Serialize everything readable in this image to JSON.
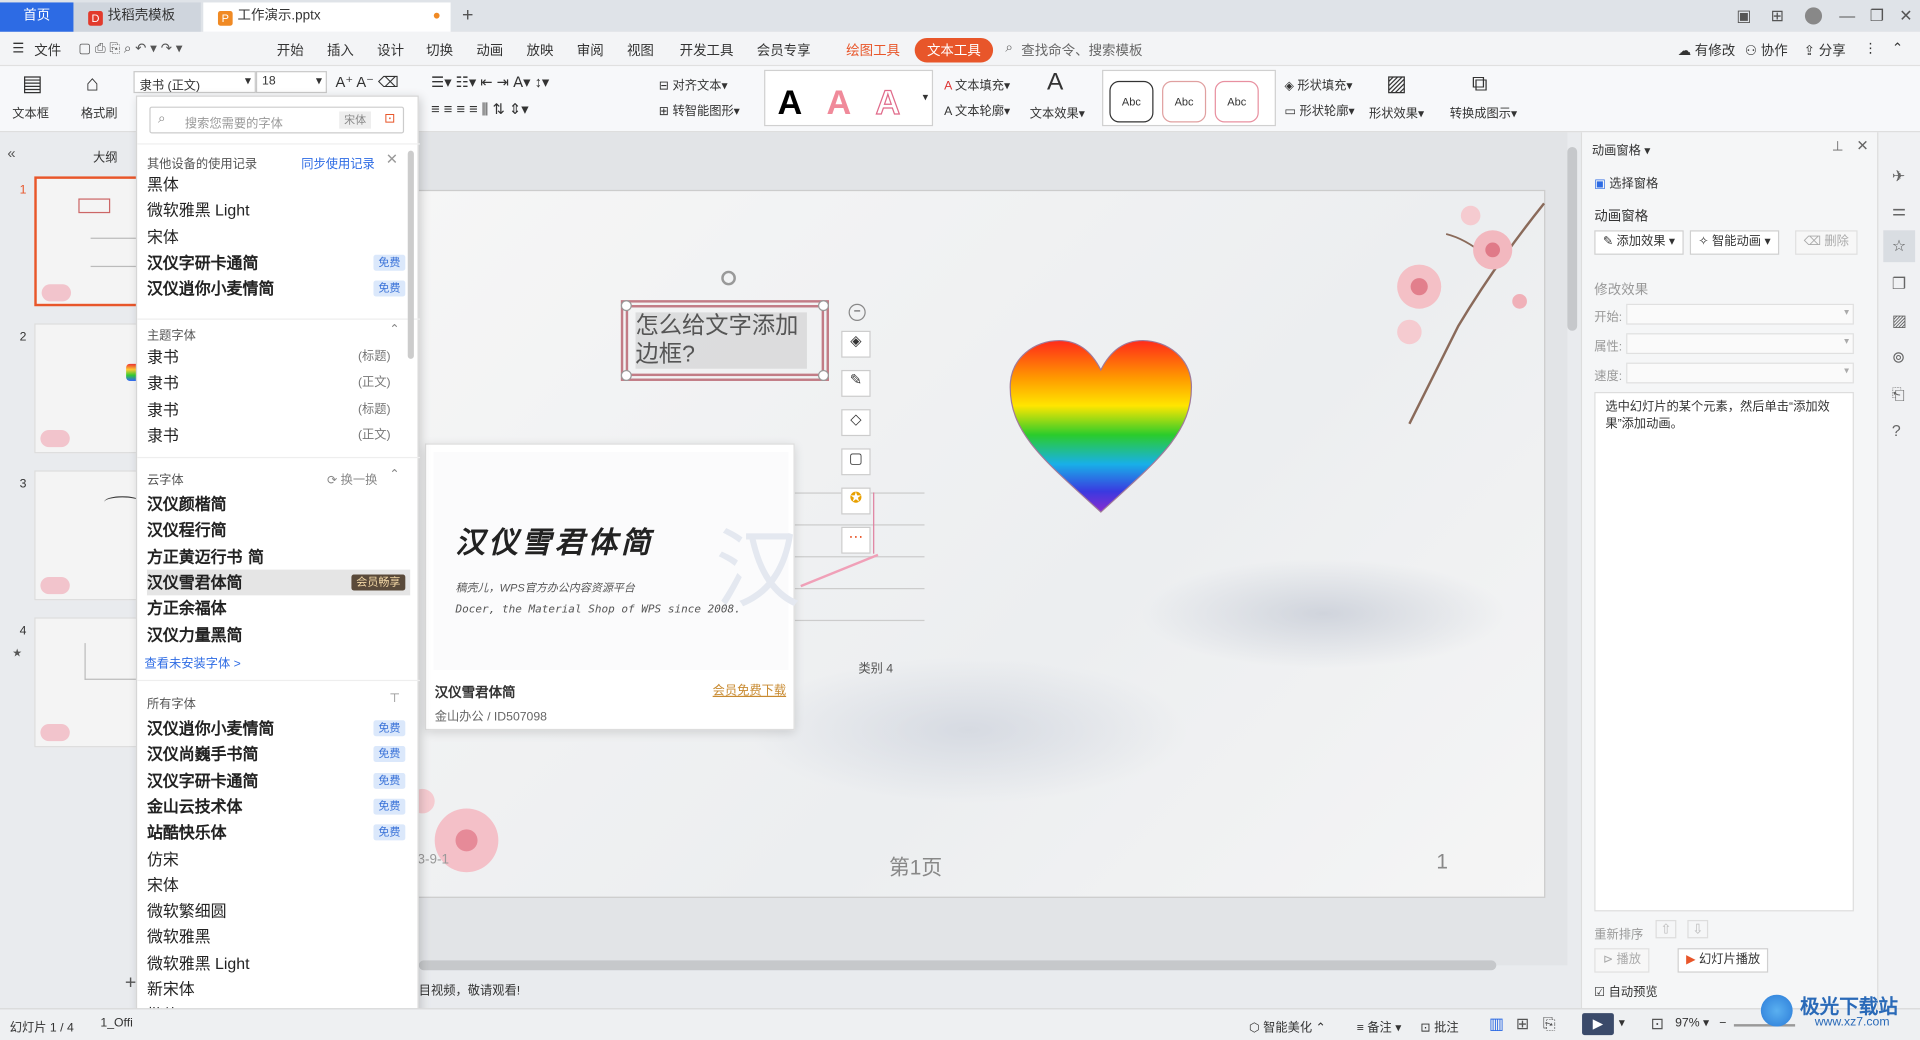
{
  "tabs": {
    "home": "首页",
    "template": "找稻壳模板",
    "file": "工作演示.pptx"
  },
  "menu": {
    "file": "文件",
    "items": [
      "开始",
      "插入",
      "设计",
      "切换",
      "动画",
      "放映",
      "审阅",
      "视图",
      "开发工具",
      "会员专享"
    ],
    "draw_tools": "绘图工具",
    "text_tools": "文本工具",
    "search": "查找命令、搜索模板",
    "modified": "有修改",
    "collab": "协作",
    "share": "分享"
  },
  "ribbon": {
    "textbox": "文本框",
    "format_brush": "格式刷",
    "font_name": "隶书 (正文)",
    "font_size": "18",
    "align_text": "对齐文本",
    "smart_shape": "转智能图形",
    "text_fill": "文本填充",
    "text_outline": "文本轮廓",
    "text_effect": "文本效果",
    "abc": "Abc",
    "shape_fill": "形状填充",
    "shape_outline": "形状轮廓",
    "shape_effect": "形状效果",
    "convert": "转换成图示"
  },
  "leftnav": {
    "outline": "大纲",
    "slides": [
      "1",
      "2",
      "3",
      "4"
    ]
  },
  "font_panel": {
    "search_placeholder": "搜索您需要的字体",
    "search_hint": "宋体",
    "recent_title": "其他设备的使用记录",
    "sync": "同步使用记录",
    "recent": [
      {
        "name": "黑体",
        "badge": ""
      },
      {
        "name": "微软雅黑 Light",
        "badge": ""
      },
      {
        "name": "宋体",
        "badge": ""
      },
      {
        "name": "汉仪字研卡通简",
        "badge": "免费"
      },
      {
        "name": "汉仪逍你小麦情简",
        "badge": "免费"
      }
    ],
    "theme_title": "主题字体",
    "theme": [
      {
        "name": "隶书",
        "tag": "(标题)"
      },
      {
        "name": "隶书",
        "tag": "(正文)"
      },
      {
        "name": "隶书",
        "tag": "(标题)"
      },
      {
        "name": "隶书",
        "tag": "(正文)"
      }
    ],
    "cloud_title": "云字体",
    "swap": "换一换",
    "cloud": [
      {
        "name": "汉仪颜楷简",
        "badge": ""
      },
      {
        "name": "汉仪程行简",
        "badge": ""
      },
      {
        "name": "方正黄迈行书 简",
        "badge": ""
      },
      {
        "name": "汉仪雪君体简",
        "badge": "会员畅享"
      },
      {
        "name": "方正余福体",
        "badge": ""
      },
      {
        "name": "汉仪力量黑简",
        "badge": ""
      }
    ],
    "uninstalled": "查看未安装字体 >",
    "all_title": "所有字体",
    "all": [
      {
        "name": "汉仪逍你小麦情简",
        "badge": "免费"
      },
      {
        "name": "汉仪尚巍手书简",
        "badge": "免费"
      },
      {
        "name": "汉仪字研卡通简",
        "badge": "免费"
      },
      {
        "name": "金山云技术体",
        "badge": "免费"
      },
      {
        "name": "站酷快乐体",
        "badge": "免费"
      },
      {
        "name": "仿宋",
        "badge": ""
      },
      {
        "name": "宋体",
        "badge": ""
      },
      {
        "name": "微软繁细圆",
        "badge": ""
      },
      {
        "name": "微软雅黑",
        "badge": ""
      },
      {
        "name": "微软雅黑 Light",
        "badge": ""
      },
      {
        "name": "新宋体",
        "badge": ""
      },
      {
        "name": "楷体",
        "badge": ""
      }
    ]
  },
  "preview": {
    "title": "汉仪雪君体简",
    "line1": "稿壳儿，WPS官方办公内容资源平台",
    "line2": "Docer, the Material Shop of WPS since 2008.",
    "font_name": "汉仪雪君体简",
    "source": "金山办公 / ID507098",
    "download": "会员免费下载"
  },
  "slide": {
    "text": "怎么给文字添加边框?",
    "page_label": "第1页",
    "page_num": "1",
    "date_frag": "3-9-1",
    "category": "类别 4",
    "notes": "目视频，敬请观看!"
  },
  "rpanel": {
    "title": "动画窗格",
    "select_pane": "选择窗格",
    "section": "动画窗格",
    "add_effect": "添加效果",
    "smart_anim": "智能动画",
    "delete": "删除",
    "modify": "修改效果",
    "start": "开始:",
    "property": "属性:",
    "speed": "速度:",
    "hint": "选中幻灯片的某个元素，然后单击“添加效果”添加动画。",
    "reorder": "重新排序",
    "play": "播放",
    "slideshow": "幻灯片播放",
    "auto_preview": "自动预览"
  },
  "status": {
    "slide_info": "幻灯片 1 / 4",
    "theme": "1_Offi",
    "beautify": "智能美化",
    "notes": "备注",
    "comment": "批注",
    "zoom": "97%"
  },
  "watermark": {
    "text": "极光下载站",
    "url": "www.xz7.com"
  },
  "colors": {
    "accent_blue": "#2d6be4",
    "accent_orange": "#e8562a",
    "vip_badge": "#5a4a3a",
    "free_badge": "#3a72d8"
  }
}
